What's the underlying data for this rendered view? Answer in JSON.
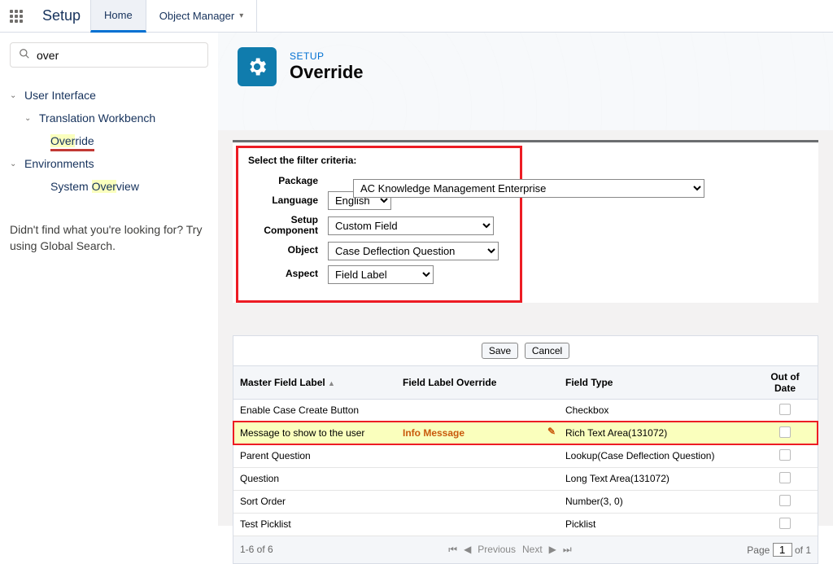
{
  "topbar": {
    "app_title": "Setup",
    "tabs": [
      {
        "label": "Home",
        "active": true
      },
      {
        "label": "Object Manager",
        "active": false
      }
    ]
  },
  "sidebar": {
    "search_value": "over",
    "tree": [
      {
        "label": "User Interface",
        "level": 0
      },
      {
        "label": "Translation Workbench",
        "level": 1
      },
      {
        "label": "Override",
        "level": 2,
        "current": true,
        "hl_start": 0,
        "hl_len": 4
      },
      {
        "label": "Environments",
        "level": 0
      },
      {
        "label": "System Overview",
        "level": 2,
        "current": false,
        "hl_start": 7,
        "hl_len": 4
      }
    ],
    "no_result": "Didn't find what you're looking for? Try using Global Search."
  },
  "page": {
    "eyebrow": "SETUP",
    "title": "Override"
  },
  "filter": {
    "title": "Select the filter criteria:",
    "package_label": "Package",
    "package_value": "AC Knowledge Management Enterprise",
    "language_label": "Language",
    "language_value": "English",
    "setup_component_label": "Setup Component",
    "setup_component_value": "Custom Field",
    "object_label": "Object",
    "object_value": "Case Deflection Question",
    "aspect_label": "Aspect",
    "aspect_value": "Field Label"
  },
  "actions": {
    "save": "Save",
    "cancel": "Cancel"
  },
  "table": {
    "headers": {
      "master": "Master Field Label",
      "override": "Field Label Override",
      "type": "Field Type",
      "ood": "Out of Date"
    },
    "rows": [
      {
        "master": "Enable Case Create Button",
        "override": "",
        "type": "Checkbox",
        "highlight": false
      },
      {
        "master": "Message to show to the user",
        "override": "Info Message",
        "type": "Rich Text Area(131072)",
        "highlight": true
      },
      {
        "master": "Parent Question",
        "override": "",
        "type": "Lookup(Case Deflection Question)",
        "highlight": false
      },
      {
        "master": "Question",
        "override": "",
        "type": "Long Text Area(131072)",
        "highlight": false
      },
      {
        "master": "Sort Order",
        "override": "",
        "type": "Number(3, 0)",
        "highlight": false
      },
      {
        "master": "Test Picklist",
        "override": "",
        "type": "Picklist",
        "highlight": false
      }
    ]
  },
  "pager": {
    "count": "1-6 of 6",
    "prev": "Previous",
    "next": "Next",
    "page_label_pre": "Page",
    "page_value": "1",
    "page_label_post": "of 1"
  }
}
